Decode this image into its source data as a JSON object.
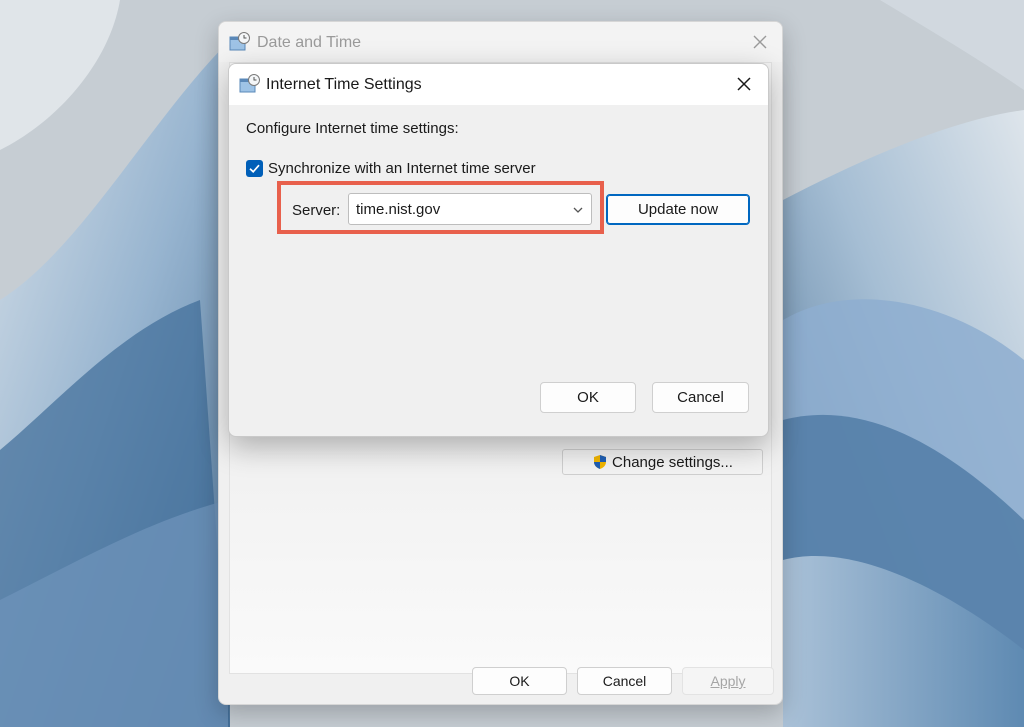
{
  "wallpaper": {
    "colors": {
      "base": "#c9d0d6",
      "ribbon_light": "#a9c3da",
      "ribbon_mid": "#6f97bd",
      "ribbon_dark": "#2f5f8c"
    }
  },
  "date_time_window": {
    "title": "Date and Time",
    "icon": "clock-calendar-icon",
    "close_icon": "close-icon",
    "change_settings_label": "Change settings...",
    "change_settings_icon": "uac-shield-icon",
    "buttons": {
      "ok": "OK",
      "cancel": "Cancel",
      "apply": "Apply"
    }
  },
  "internet_time_dialog": {
    "title": "Internet Time Settings",
    "icon": "clock-calendar-icon",
    "close_icon": "close-icon",
    "heading": "Configure Internet time settings:",
    "sync_checkbox": {
      "label": "Synchronize with an Internet time server",
      "checked": true
    },
    "server": {
      "label": "Server:",
      "value": "time.nist.gov",
      "chevron_icon": "chevron-down-icon"
    },
    "update_now_label": "Update now",
    "buttons": {
      "ok": "OK",
      "cancel": "Cancel"
    },
    "highlight_color": "#e8604c",
    "accent_color": "#005fb8"
  }
}
